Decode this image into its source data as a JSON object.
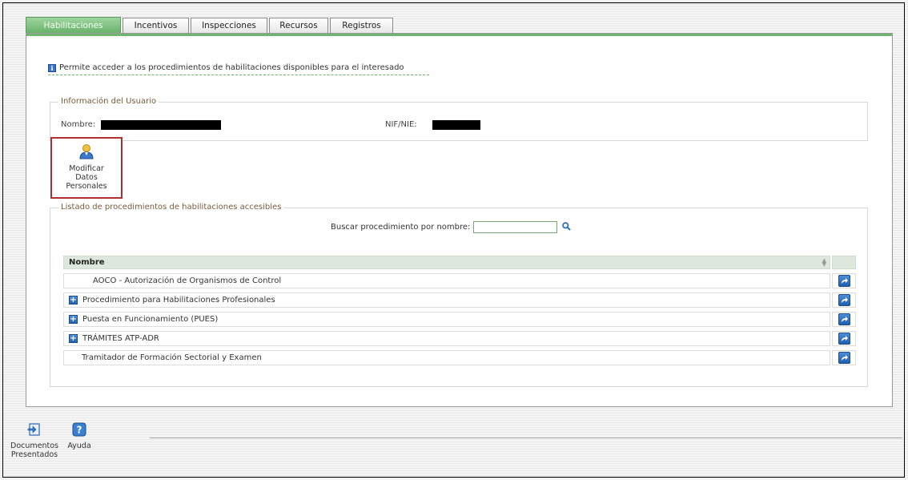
{
  "tabs": [
    {
      "label": "Habilitaciones",
      "active": true
    },
    {
      "label": "Incentivos",
      "active": false
    },
    {
      "label": "Inspecciones",
      "active": false
    },
    {
      "label": "Recursos",
      "active": false
    },
    {
      "label": "Registros",
      "active": false
    }
  ],
  "info": {
    "text": "Permite acceder a los procedimientos de habilitaciones disponibles para el interesado",
    "icon": "info-icon"
  },
  "user_info": {
    "legend": "Información del Usuario",
    "name_label": "Nombre:",
    "nif_label": "NIF/NIE:"
  },
  "modify_button": {
    "label": "Modificar Datos Personales",
    "icon": "user-icon"
  },
  "procedures": {
    "legend": "Listado de procedimientos de habilitaciones accesibles",
    "search_label": "Buscar procedimiento por nombre:",
    "search_value": "",
    "column_header": "Nombre",
    "rows": [
      {
        "name": "AOCO - Autorización de Organismos de Control",
        "expandable": false
      },
      {
        "name": "Procedimiento para Habilitaciones Profesionales",
        "expandable": true
      },
      {
        "name": "Puesta en Funcionamiento (PUES)",
        "expandable": true
      },
      {
        "name": "TRÁMITES ATP-ADR",
        "expandable": true
      },
      {
        "name": "Tramitador de Formación Sectorial y Examen",
        "expandable": false
      }
    ]
  },
  "bottom_toolbar": {
    "documents_label": "Documentos Presentados",
    "help_label": "Ayuda"
  },
  "colors": {
    "accent_green": "#6fb46f",
    "link_blue": "#1f5fb4",
    "highlight_red": "#b03030"
  }
}
